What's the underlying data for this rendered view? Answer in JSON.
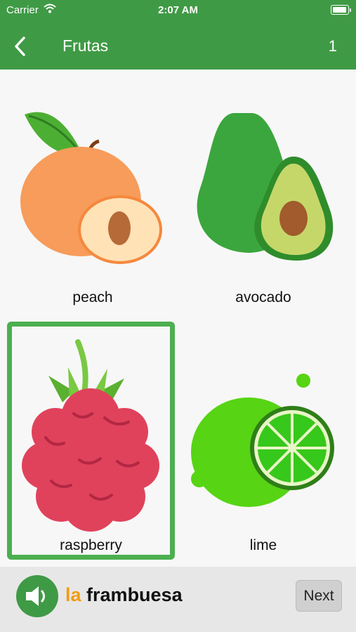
{
  "status_bar": {
    "carrier": "Carrier",
    "time": "2:07 AM"
  },
  "nav": {
    "back_icon": "chevron-left-icon",
    "title": "Frutas",
    "counter": "1"
  },
  "cards": [
    {
      "label": "peach",
      "icon": "peach-icon",
      "selected": false
    },
    {
      "label": "avocado",
      "icon": "avocado-icon",
      "selected": false
    },
    {
      "label": "raspberry",
      "icon": "raspberry-icon",
      "selected": true
    },
    {
      "label": "lime",
      "icon": "lime-icon",
      "selected": false
    }
  ],
  "footer": {
    "speaker_icon": "speaker-icon",
    "article": "la",
    "word": "frambuesa",
    "next_label": "Next"
  },
  "colors": {
    "header": "#3f9a45",
    "selected_border": "#4caf50",
    "article": "#f39c12"
  }
}
